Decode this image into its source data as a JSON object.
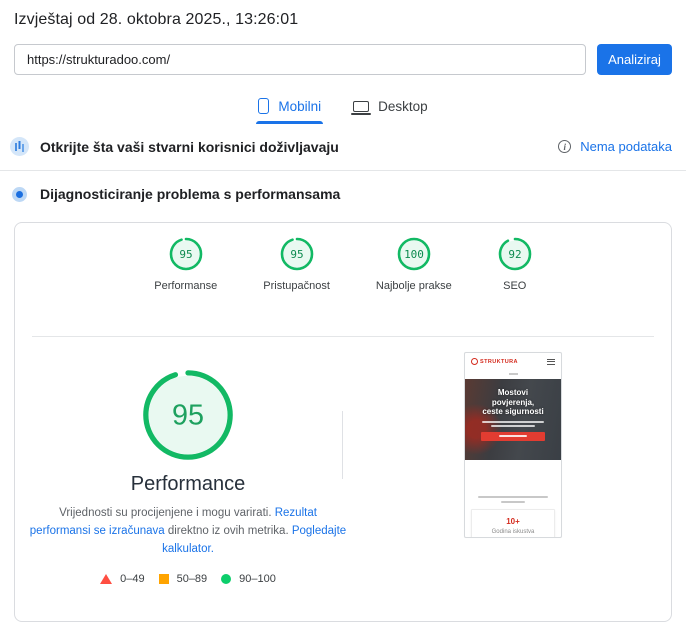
{
  "header": {
    "title": "Izvještaj od 28. oktobra 2025., 13:26:01"
  },
  "analyzer": {
    "url_value": "https://strukturadoo.com/",
    "analyze_button": "Analiziraj"
  },
  "tabs": {
    "mobile": "Mobilni",
    "desktop": "Desktop"
  },
  "field_section": {
    "title": "Otkrijte šta vaši stvarni korisnici doživljavaju",
    "no_data_label": "Nema podataka"
  },
  "diagnostics_section": {
    "title": "Dijagnosticiranje problema s performansama"
  },
  "scores": {
    "performanse": {
      "label": "Performanse",
      "score": 95
    },
    "pristupacnost": {
      "label": "Pristupačnost",
      "score": 95
    },
    "najbolje_prakse": {
      "label": "Najbolje prakse",
      "score": 100
    },
    "seo": {
      "label": "SEO",
      "score": 92
    }
  },
  "performance_panel": {
    "score": 95,
    "title": "Performance",
    "note": {
      "text1": "Vrijednosti su procijenjene i mogu varirati. ",
      "link1": "Rezultat performansi se izračunava",
      "text2": " direktno iz ovih metrika. ",
      "link2": "Pogledajte kalkulator."
    },
    "legend": [
      {
        "range": "0–49",
        "color": "#ff4e42"
      },
      {
        "range": "50–89",
        "color": "#ffa400"
      },
      {
        "range": "90–100",
        "color": "#0cce6b"
      }
    ]
  },
  "site_preview": {
    "brand": "STRUKTURA",
    "hero_line1": "Mostovi",
    "hero_line2": "povjerenja,",
    "hero_line3": "ceste sigurnosti",
    "stat_value": "10+",
    "stat_label": "Godina iskustva"
  },
  "colors": {
    "accent_blue": "#1a73e8",
    "pass_green": "#0cce6b",
    "average_orange": "#ffa400",
    "fail_red": "#ff4e42"
  }
}
